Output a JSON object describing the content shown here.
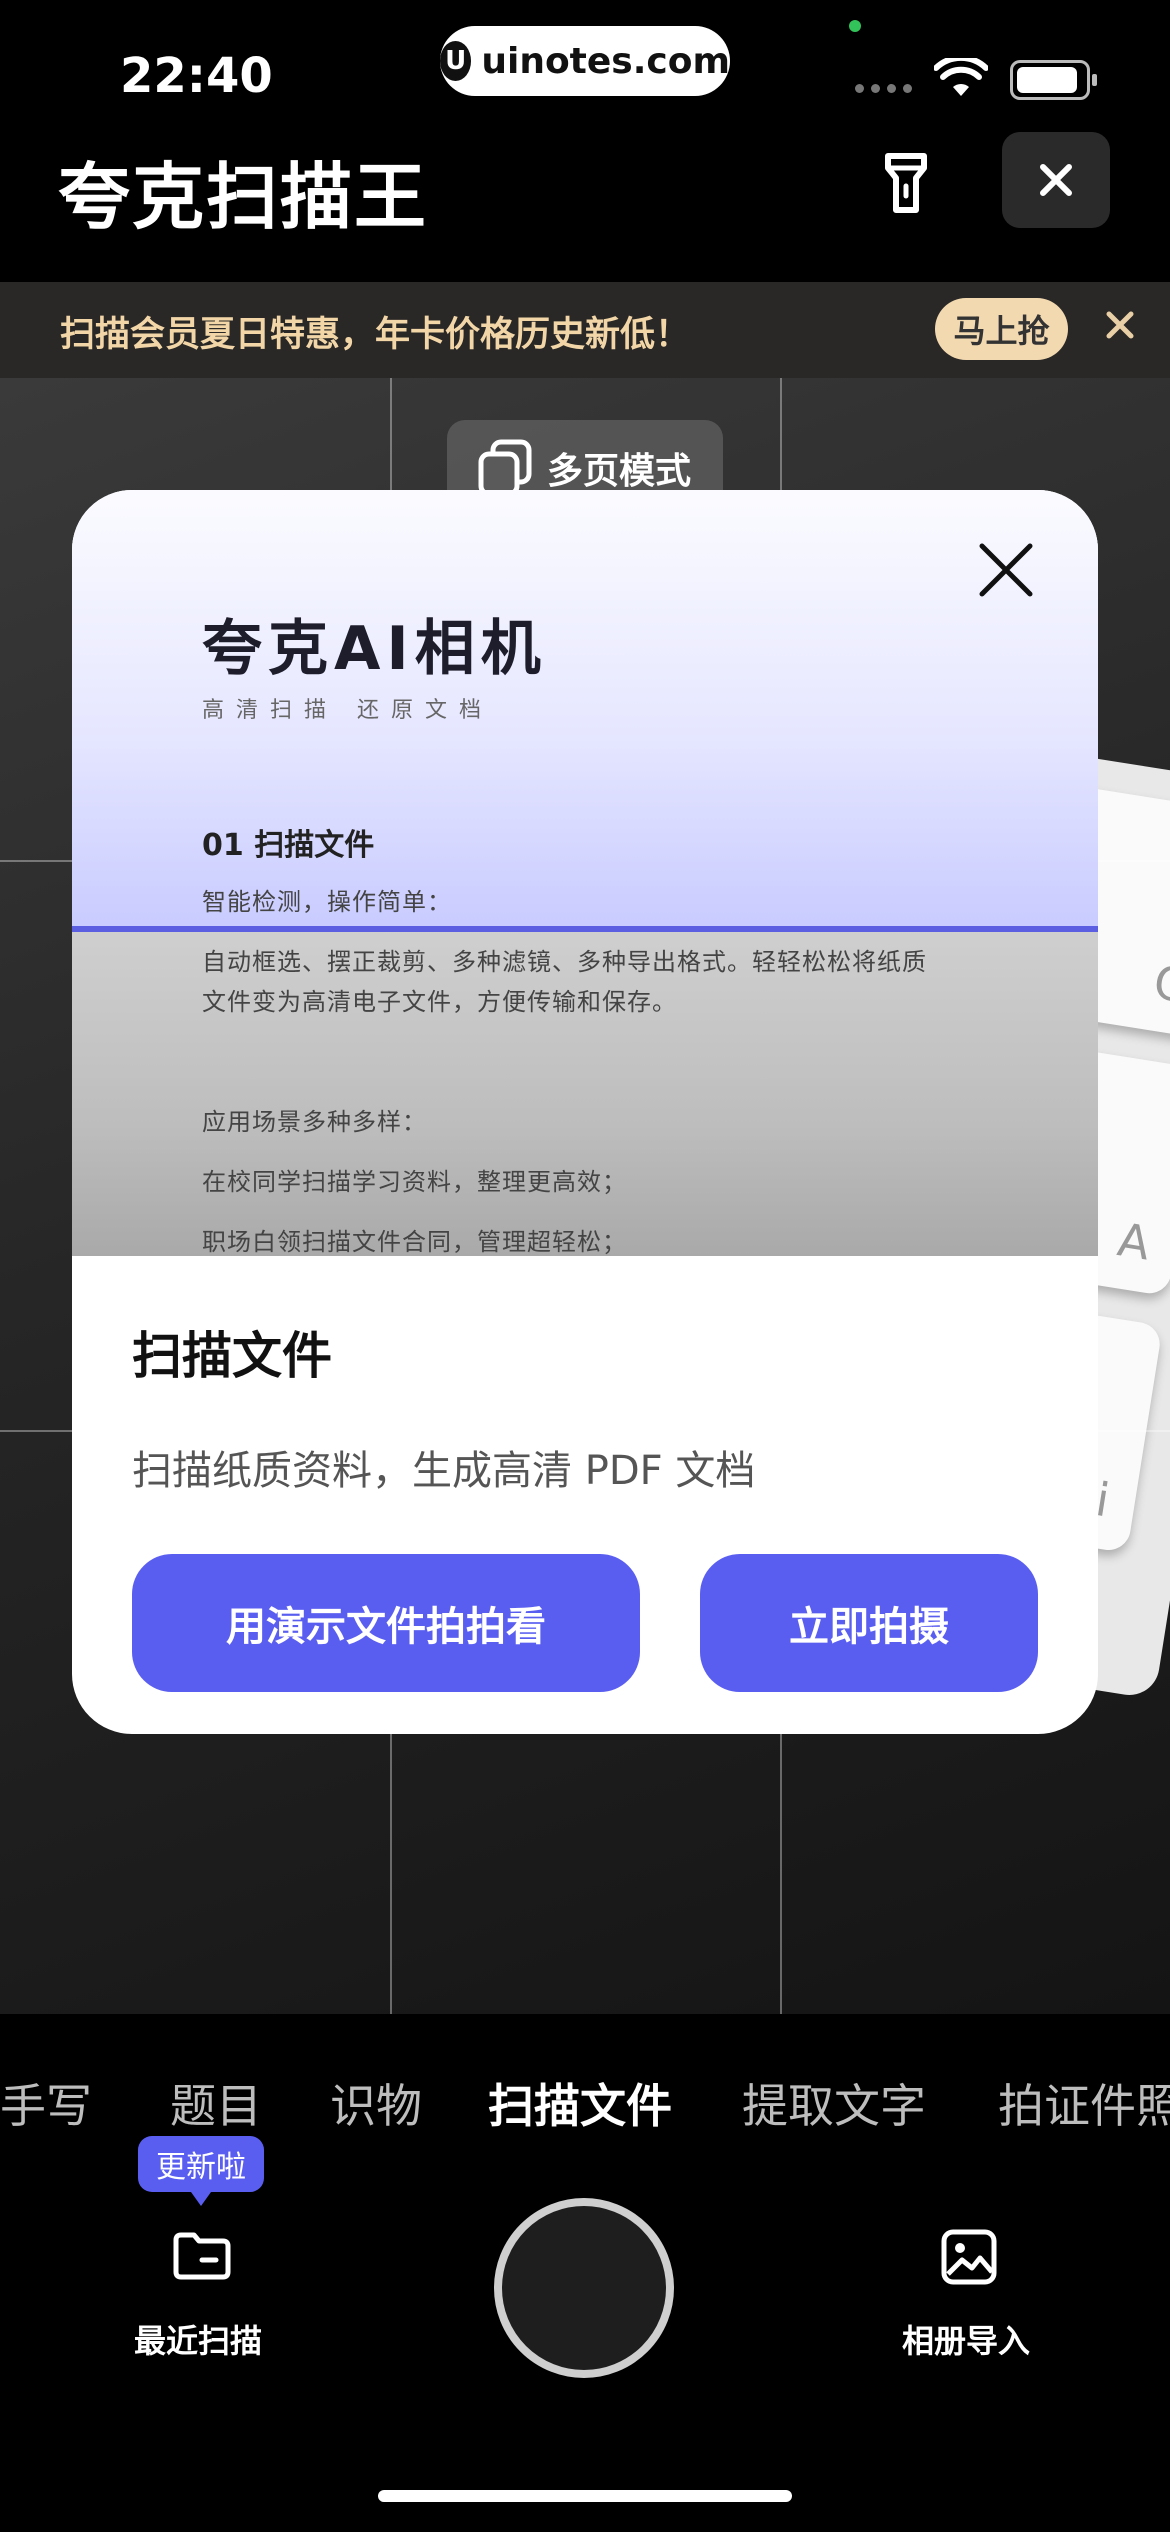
{
  "status": {
    "time": "22:40",
    "site": "uinotes.com",
    "logo_letter": "U"
  },
  "header": {
    "app_title": "夸克扫描王"
  },
  "promo": {
    "text": "扫描会员夏日特惠，年卡价格历史新低！",
    "button": "马上抢"
  },
  "camera": {
    "multi_page_label": "多页模式",
    "keys": [
      "Q",
      "A",
      "opti"
    ]
  },
  "modal": {
    "preview": {
      "title": "夸克AI相机",
      "subtitle": "高清扫描  还原文档",
      "section": "01 扫描文件",
      "lines": [
        "智能检测，操作简单：",
        "自动框选、摆正裁剪、多种滤镜、多种导出格式。轻轻松松将纸质",
        "文件变为高清电子文件，方便传输和保存。",
        "应用场景多种多样：",
        "在校同学扫描学习资料，整理更高效；",
        "职场白领扫描文件合同，管理超轻松；"
      ]
    },
    "title": "扫描文件",
    "description": "扫描纸质资料，生成高清 PDF 文档",
    "demo_button": "用演示文件拍拍看",
    "shoot_button": "立即拍摄"
  },
  "modes": [
    "去手写",
    "题目",
    "识物",
    "扫描文件",
    "提取文字",
    "拍证件照"
  ],
  "active_mode": "扫描文件",
  "bottom": {
    "update_badge": "更新啦",
    "recent_label": "最近扫描",
    "album_label": "相册导入"
  }
}
